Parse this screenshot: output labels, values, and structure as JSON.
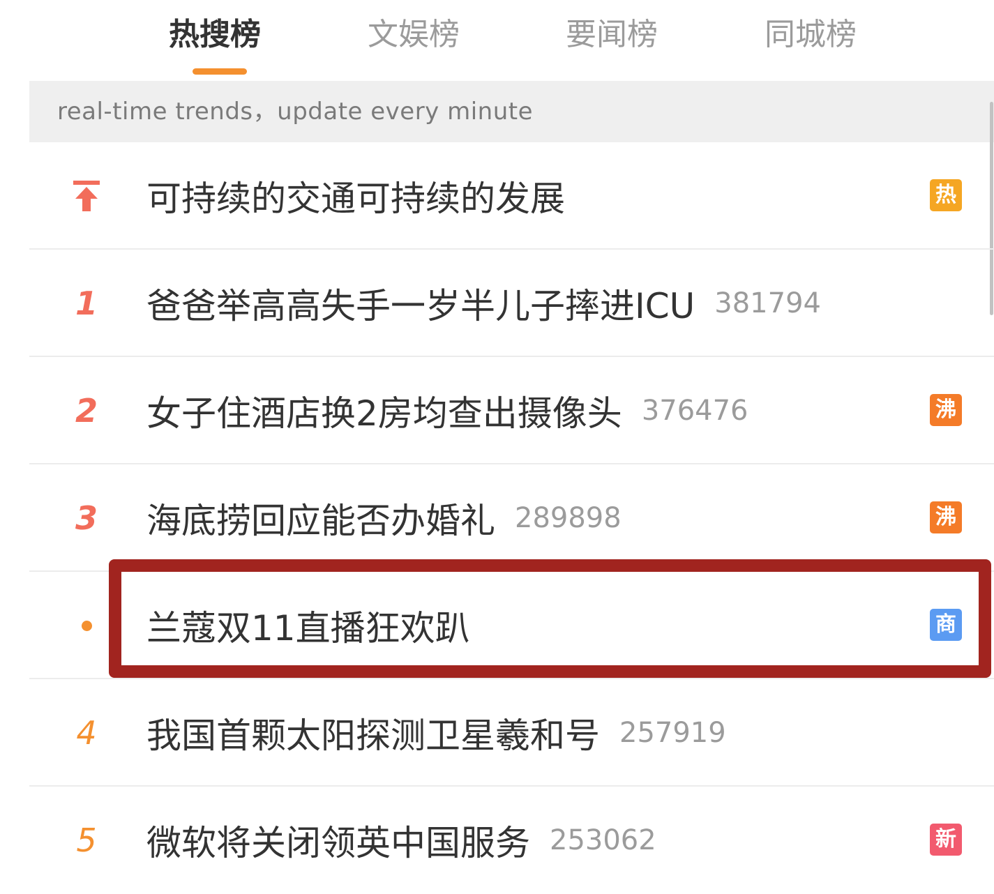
{
  "tabs": [
    {
      "label": "热搜榜",
      "active": true
    },
    {
      "label": "文娱榜",
      "active": false
    },
    {
      "label": "要闻榜",
      "active": false
    },
    {
      "label": "同城榜",
      "active": false
    }
  ],
  "notice": "real-time trends，update every minute",
  "colors": {
    "accent": "#f4902f",
    "rank_top": "#f26d5b",
    "badge_hot": "#f5a623",
    "badge_boil": "#f47b28",
    "badge_ad": "#5b9bf2",
    "badge_new": "#f25a6e",
    "highlight": "#a1241f"
  },
  "list": [
    {
      "rank": "",
      "rank_icon": "pin-top-icon",
      "title": "可持续的交通可持续的发展",
      "count": "",
      "badge": "热",
      "badge_color": "#f5a623"
    },
    {
      "rank": "1",
      "title": "爸爸举高高失手一岁半儿子摔进ICU",
      "count": "381794",
      "badge": "",
      "badge_color": ""
    },
    {
      "rank": "2",
      "title": "女子住酒店换2房均查出摄像头",
      "count": "376476",
      "badge": "沸",
      "badge_color": "#f47b28"
    },
    {
      "rank": "3",
      "title": "海底捞回应能否办婚礼",
      "count": "289898",
      "badge": "沸",
      "badge_color": "#f47b28"
    },
    {
      "rank": "",
      "rank_icon": "dot-icon",
      "title": "兰蔻双11直播狂欢趴",
      "count": "",
      "badge": "商",
      "badge_color": "#5b9bf2",
      "highlighted": true
    },
    {
      "rank": "4",
      "title": "我国首颗太阳探测卫星羲和号",
      "count": "257919",
      "badge": "",
      "badge_color": ""
    },
    {
      "rank": "5",
      "title": "微软将关闭领英中国服务",
      "count": "253062",
      "badge": "新",
      "badge_color": "#f25a6e"
    }
  ]
}
